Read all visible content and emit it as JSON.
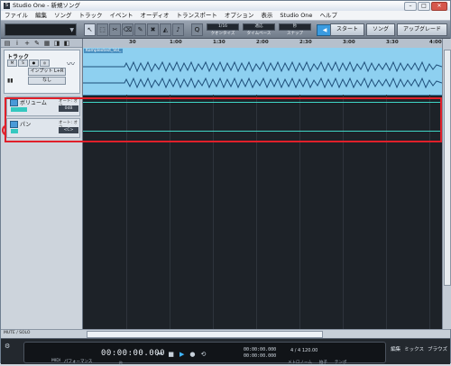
{
  "window": {
    "title": "Studio One - 新規ソング",
    "app_icon_label": "S"
  },
  "menu": [
    "ファイル",
    "編集",
    "ソング",
    "トラック",
    "イベント",
    "オーディオ",
    "トランスポート",
    "オプション",
    "表示",
    "Studio One",
    "ヘルプ"
  ],
  "toolbar": {
    "snap_groups": [
      {
        "value": "1/16",
        "label": "クオンタイズ"
      },
      {
        "value": "適応",
        "label": "タイムベース"
      },
      {
        "value": "秒",
        "label": "スナップ"
      }
    ],
    "right_buttons": [
      "スタート",
      "ソング",
      "アップグレード"
    ]
  },
  "track": {
    "name": "トラック",
    "buttons": [
      "M",
      "S",
      "●",
      "◎"
    ],
    "input_label": "インプット L+R",
    "output_label": "なし"
  },
  "automation": {
    "volume": {
      "name": "ボリューム",
      "mode": "オート: オフ",
      "value": "0dB"
    },
    "pan": {
      "name": "パン",
      "mode": "オート: オフ",
      "value": "<C>"
    }
  },
  "ruler_labels": [
    "30",
    "1:00",
    "1:30",
    "2:00",
    "2:30",
    "3:00",
    "3:30",
    "4:00"
  ],
  "event_name": "Komplextest_Vol_",
  "bottom_strip": {
    "label": "MUTE / SOLO"
  },
  "transport": {
    "time": "00:00:00.000",
    "time_label": "秒",
    "midi_label": "MIDI",
    "performance_label": "パフォーマンス",
    "loc_left": "00:00:00.000",
    "loc_right": "00:00:00.000",
    "signature": "4 / 4",
    "tempo": "120.00",
    "labels": [
      "メトロノーム",
      "拍子",
      "テンポ"
    ],
    "right_tabs": [
      "編集",
      "ミックス",
      "ブラウズ"
    ]
  },
  "colors": {
    "accent": "#3a9be0",
    "annotation_red": "#e0202a",
    "automation_line": "#3fd6c6",
    "event": "#8ed0f0"
  }
}
